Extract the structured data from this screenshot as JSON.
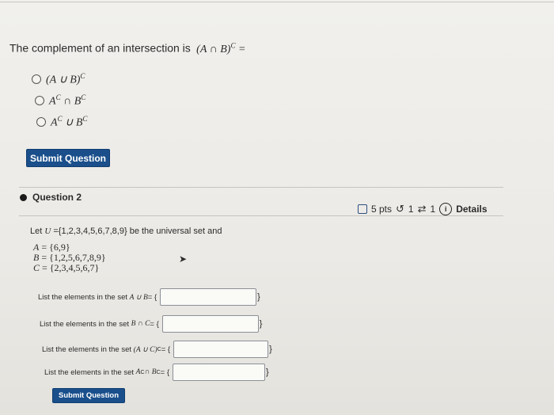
{
  "question1": {
    "text": "The complement of an intersection is",
    "expression": "(A ∩ B)",
    "superscript": "C",
    "equals": "=",
    "options": [
      {
        "base": "(A ∪ B)",
        "sup": "C",
        "rest": "",
        "rest_sup": ""
      },
      {
        "base": "A",
        "sup": "C",
        "rest": " ∩ B",
        "rest_sup": "C"
      },
      {
        "base": "A",
        "sup": "C",
        "rest": " ∪ B",
        "rest_sup": "C"
      }
    ],
    "submit_label": "Submit Question"
  },
  "question2": {
    "title": "Question 2",
    "points": "5 pts",
    "retries": "1",
    "attempts": "1",
    "details_label": "Details",
    "intro_prefix": "Let ",
    "intro_var": "U",
    "intro_set": " ={1,2,3,4,5,6,7,8,9} be the universal set and",
    "sets": [
      {
        "name": "A",
        "value": " = {6,9}"
      },
      {
        "name": "B",
        "value": " = {1,2,5,6,7,8,9}"
      },
      {
        "name": "C",
        "value": " = {2,3,4,5,6,7}"
      }
    ],
    "tasks": [
      {
        "label": "List the elements in the set",
        "expr": "A ∪ B",
        "sup": "",
        "tail": "= {",
        "value": "",
        "close": "}"
      },
      {
        "label": "List the elements in the set",
        "expr": "B ∩ C",
        "sup": "",
        "tail": "= {",
        "value": "",
        "close": "}"
      },
      {
        "label": "List the elements in the set",
        "expr": "(A ∪ C)",
        "sup": "C",
        "tail": "= {",
        "value": "",
        "close": "}"
      },
      {
        "label": "List the elements in the set",
        "expr": "A",
        "sup": "C",
        "expr2": " ∩ B",
        "sup2": "C",
        "tail": "= {",
        "value": "",
        "close": "}"
      }
    ],
    "submit_label": "Submit Question"
  },
  "colors": {
    "accent": "#1a4f8b",
    "bullet": "#1a1a1a",
    "icon_blue": "#2c4f80"
  }
}
